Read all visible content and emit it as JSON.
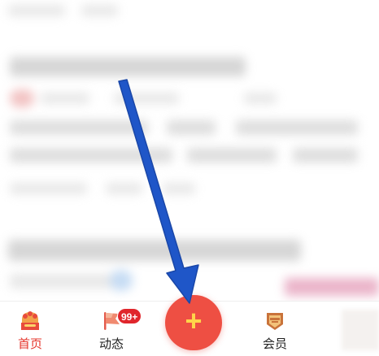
{
  "bottom_nav": {
    "home_label": "首页",
    "dynamics_label": "动态",
    "dynamics_badge": "99+",
    "post_glyph": "+",
    "member_label": "会员",
    "active_color": "#e5352b",
    "post_button_color": "#ee4f43"
  },
  "icons": [
    "home-icon",
    "flag-icon",
    "plus-icon",
    "member-badge-icon"
  ],
  "annotation": {
    "arrow_color": "#1f56c8"
  }
}
